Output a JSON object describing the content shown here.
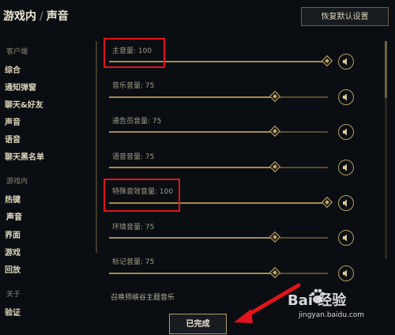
{
  "header": {
    "breadcrumb_parent": "游戏内",
    "separator": "/",
    "title": "声音",
    "reset_button": "恢复默认设置"
  },
  "sidebar": {
    "client_heading": "客户端",
    "client_items": [
      "综合",
      "通知弹窗",
      "聊天&好友",
      "声音",
      "语音",
      "聊天黑名单"
    ],
    "ingame_heading": "游戏内",
    "ingame_items": [
      "热键",
      "声音",
      "界面",
      "游戏",
      "回放"
    ],
    "about_heading": "关于",
    "about_items": [
      "验证"
    ],
    "active_item": "声音"
  },
  "sliders": [
    {
      "label": "主音量: 100",
      "value": 100
    },
    {
      "label": "音乐音量: 75",
      "value": 75
    },
    {
      "label": "通告员音量: 75",
      "value": 75
    },
    {
      "label": "语音音量: 75",
      "value": 75
    },
    {
      "label": "特殊音效音量: 100",
      "value": 100
    },
    {
      "label": "环境音量: 75",
      "value": 75
    },
    {
      "label": "标记音量: 75",
      "value": 75
    }
  ],
  "music_toggle_label": "召唤师峡谷主题音乐",
  "done_button": "已完成",
  "watermark": {
    "text": "Bai 经验",
    "url": "jingyan.baidu.com"
  },
  "colors": {
    "accent_gold": "#c8aa6e",
    "highlight_red": "#e0141a",
    "arrow_red": "#e0141a",
    "background": "#0a0e13"
  },
  "icons": {
    "speaker": "speaker-icon",
    "knob": "diamond-knob-icon",
    "arrow": "red-arrow-annotation"
  }
}
